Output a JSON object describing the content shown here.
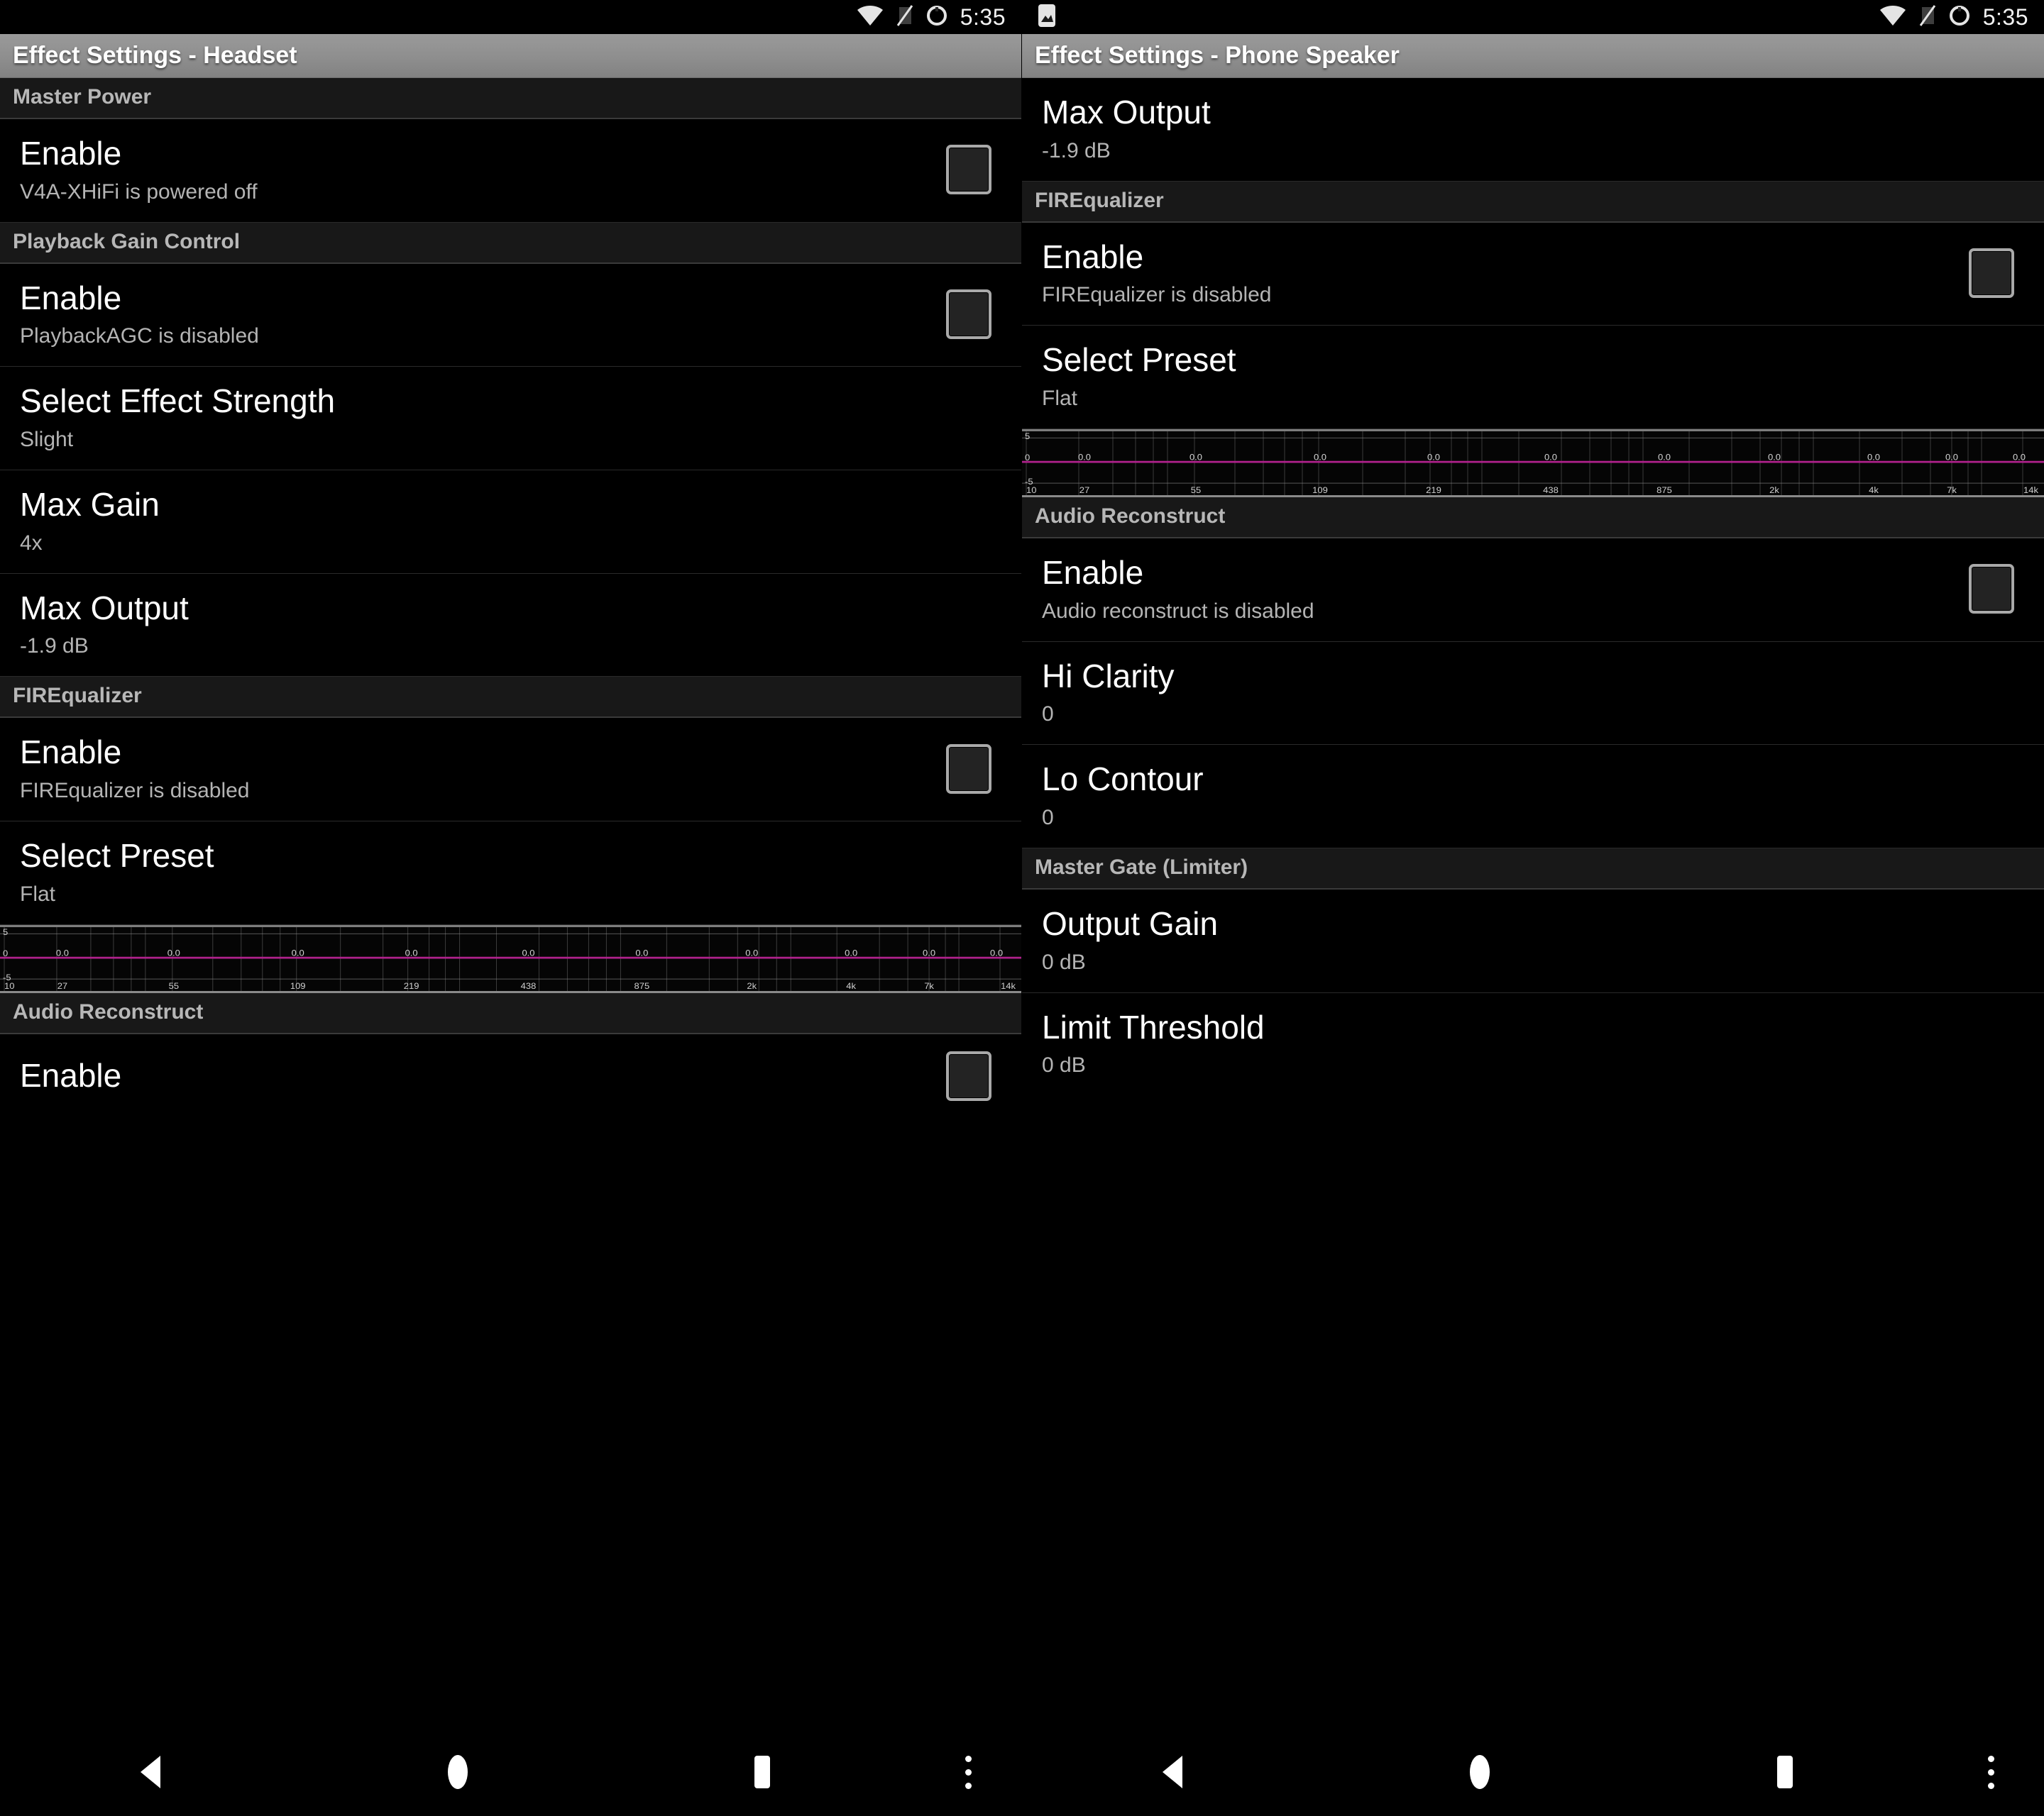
{
  "status_bar": {
    "time": "5:35",
    "icons": [
      "wifi-icon",
      "signal-off-icon",
      "battery-icon"
    ],
    "right_panel_left_icon": "image-notification-icon"
  },
  "nav_bar": {
    "back": "back-button",
    "home": "home-button",
    "recents": "recents-button",
    "overflow": "overflow-menu-button"
  },
  "eq_labels": {
    "y_top": "5",
    "y_mid": "0",
    "y_bottom": "-5",
    "freqs": [
      "10",
      "27",
      "55",
      "109",
      "219",
      "438",
      "875",
      "2k",
      "4k",
      "7k",
      "14k"
    ],
    "band_values": [
      "0.0",
      "0.0",
      "0.0",
      "0.0",
      "0.0",
      "0.0",
      "0.0",
      "0.0",
      "0.0",
      "0.0"
    ],
    "line_color": "#b0218c"
  },
  "left_panel": {
    "title": "Effect Settings - Headset",
    "sections": [
      {
        "header": "Master Power",
        "rows": [
          {
            "title": "Enable",
            "sub": "V4A-XHiFi is powered off",
            "checkbox": true,
            "checked": false
          }
        ]
      },
      {
        "header": "Playback Gain Control",
        "rows": [
          {
            "title": "Enable",
            "sub": "PlaybackAGC is disabled",
            "checkbox": true,
            "checked": false
          },
          {
            "title": "Select Effect Strength",
            "sub": "Slight",
            "checkbox": false
          },
          {
            "title": "Max Gain",
            "sub": "4x",
            "checkbox": false
          },
          {
            "title": "Max Output",
            "sub": "-1.9 dB",
            "checkbox": false
          }
        ]
      },
      {
        "header": "FIREqualizer",
        "rows": [
          {
            "title": "Enable",
            "sub": "FIREqualizer is disabled",
            "checkbox": true,
            "checked": false
          },
          {
            "title": "Select Preset",
            "sub": "Flat",
            "checkbox": false
          }
        ],
        "has_graph": true
      },
      {
        "header": "Audio Reconstruct",
        "rows": [
          {
            "title": "Enable",
            "sub": "",
            "checkbox": true,
            "checked": false
          }
        ]
      }
    ]
  },
  "right_panel": {
    "title": "Effect Settings - Phone Speaker",
    "sections": [
      {
        "header": "",
        "rows": [
          {
            "title": "Max Output",
            "sub": "-1.9 dB",
            "checkbox": false
          }
        ]
      },
      {
        "header": "FIREqualizer",
        "rows": [
          {
            "title": "Enable",
            "sub": "FIREqualizer is disabled",
            "checkbox": true,
            "checked": false
          },
          {
            "title": "Select Preset",
            "sub": "Flat",
            "checkbox": false
          }
        ],
        "has_graph": true
      },
      {
        "header": "Audio Reconstruct",
        "rows": [
          {
            "title": "Enable",
            "sub": "Audio reconstruct is disabled",
            "checkbox": true,
            "checked": false
          },
          {
            "title": "Hi Clarity",
            "sub": "0",
            "checkbox": false
          },
          {
            "title": "Lo Contour",
            "sub": "0",
            "checkbox": false
          }
        ]
      },
      {
        "header": "Master Gate (Limiter)",
        "rows": [
          {
            "title": "Output Gain",
            "sub": "0 dB",
            "checkbox": false
          },
          {
            "title": "Limit Threshold",
            "sub": "0 dB",
            "checkbox": false
          }
        ]
      }
    ]
  }
}
